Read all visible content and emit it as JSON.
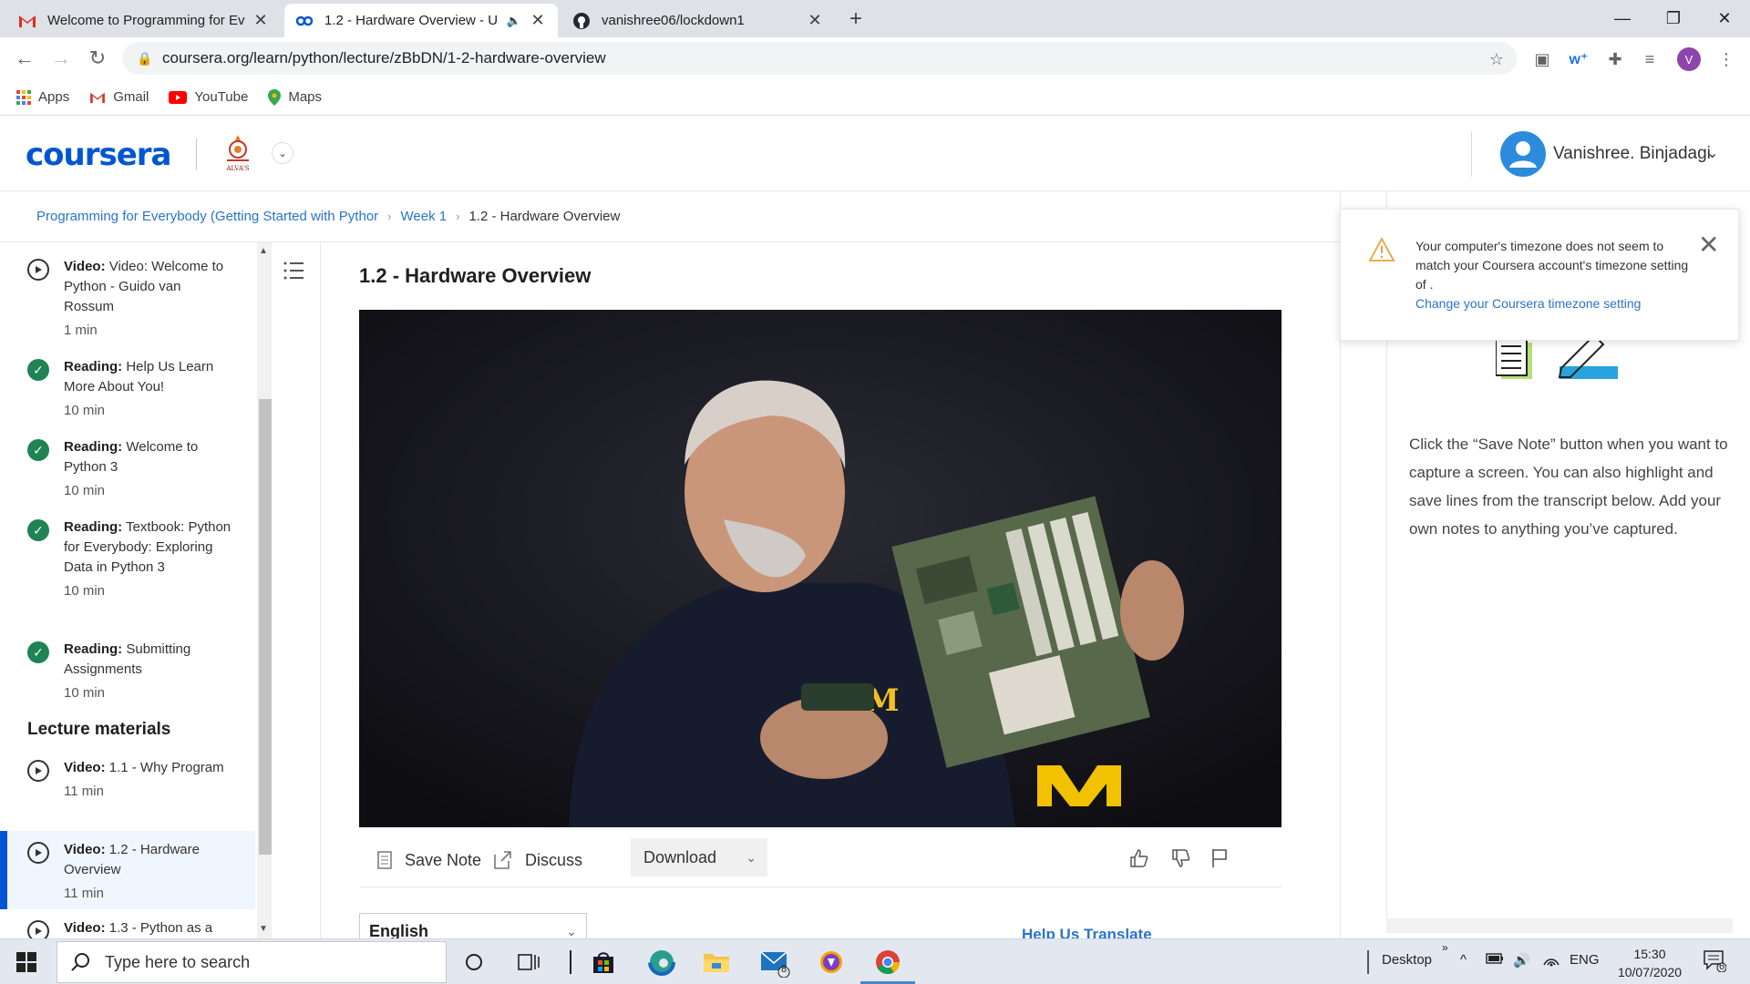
{
  "browser": {
    "tabs": [
      {
        "title": "Welcome to Programming for Ev",
        "icon": "gmail-icon"
      },
      {
        "title": "1.2 - Hardware Overview - U",
        "icon": "coursera-icon",
        "audio": true
      },
      {
        "title": "vanishree06/lockdown1",
        "icon": "github-icon"
      }
    ],
    "url": "coursera.org/learn/python/lecture/zBbDN/1-2-hardware-overview",
    "profile_initial": "V",
    "bookmarks": [
      {
        "label": "Apps",
        "icon": "apps-grid-icon"
      },
      {
        "label": "Gmail",
        "icon": "gmail-icon"
      },
      {
        "label": "YouTube",
        "icon": "youtube-icon"
      },
      {
        "label": "Maps",
        "icon": "maps-pin-icon"
      }
    ]
  },
  "header": {
    "logo": "coursera",
    "institution_logo_text": "ALVA'S",
    "user_name": "Vanishree. Binjadagi"
  },
  "breadcrumb": {
    "course": "Programming for Everybody (Getting Started with Pythor",
    "week": "Week 1",
    "current": "1.2 - Hardware Overview"
  },
  "sidebar": {
    "items": [
      {
        "type": "Video:",
        "title": "Video: Welcome to Python - Guido van Rossum",
        "duration": "1 min",
        "status": "play"
      },
      {
        "type": "Reading:",
        "title": "Help Us Learn More About You!",
        "duration": "10 min",
        "status": "done"
      },
      {
        "type": "Reading:",
        "title": "Welcome to Python 3",
        "duration": "10 min",
        "status": "done"
      },
      {
        "type": "Reading:",
        "title": "Textbook: Python for Everybody: Exploring Data in Python 3",
        "duration": "10 min",
        "status": "done"
      },
      {
        "type": "Reading:",
        "title": "Submitting Assignments",
        "duration": "10 min",
        "status": "done"
      }
    ],
    "section_title": "Lecture materials",
    "lecture_items": [
      {
        "type": "Video:",
        "title": "1.1 - Why Program",
        "duration": "11 min",
        "status": "play"
      },
      {
        "type": "Video:",
        "title": "1.2 - Hardware Overview",
        "duration": "11 min",
        "status": "play",
        "active": true
      },
      {
        "type": "Video:",
        "title": "1.3 - Python as a",
        "duration": "",
        "status": "play"
      }
    ]
  },
  "main": {
    "title": "1.2 - Hardware Overview",
    "actions": {
      "save_note": "Save Note",
      "discuss": "Discuss",
      "download": "Download"
    },
    "language": "English",
    "help_translate": "Help Us Translate"
  },
  "notes_panel": {
    "instructions": "Click the “Save Note” button when you want to capture a screen. You can also highlight and save lines from the transcript below. Add your own notes to anything you’ve captured."
  },
  "timezone_alert": {
    "message": "Your computer's timezone does not seem to match your Coursera account's timezone setting of .",
    "link": "Change your Coursera timezone setting"
  },
  "taskbar": {
    "search_placeholder": "Type here to search",
    "desktop_label": "Desktop",
    "language": "ENG",
    "time": "15:30",
    "date": "10/07/2020",
    "mail_badge": "8",
    "notification_badge": "6"
  },
  "colors": {
    "coursera_blue": "#0056d2",
    "link_blue": "#2a73cc",
    "complete_green": "#1f8354"
  }
}
